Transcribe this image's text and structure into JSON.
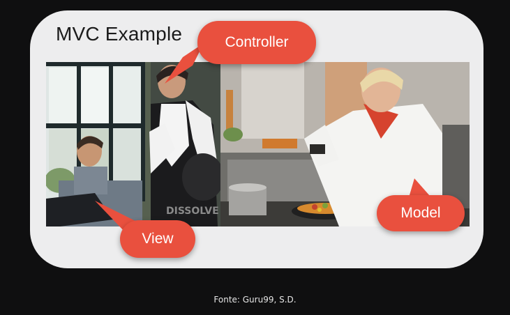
{
  "slide": {
    "title": "MVC Example",
    "caption": "Fonte: Guru99, S.D."
  },
  "callouts": {
    "controller": "Controller",
    "view": "View",
    "model": "Model"
  },
  "watermark": "DISSOLVE",
  "colors": {
    "background": "#0f0f10",
    "card": "#ededee",
    "callout": "#e9503e"
  }
}
